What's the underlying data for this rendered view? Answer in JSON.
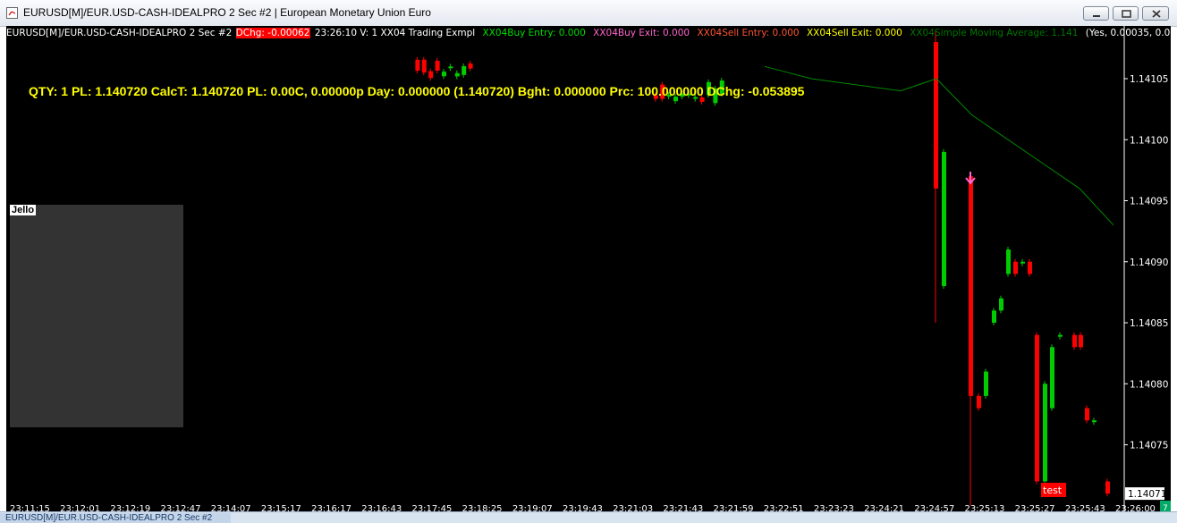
{
  "window": {
    "title": "EURUSD[M]/EUR.USD-CASH-IDEALPRO  2 Sec   #2 | European Monetary Union Euro",
    "controls": [
      "minimize",
      "maximize",
      "close"
    ]
  },
  "chart_header": {
    "symbol": "EURUSD[M]/EUR.USD-CASH-IDEALPRO  2 Sec   #2",
    "dchg": "DChg: -0.00062",
    "time_volume": "23:26:10 V: 1 XX04 Trading Exmpl",
    "buy_entry": "XX04Buy Entry: 0.000",
    "buy_exit": "XX04Buy Exit: 0.000",
    "sell_entry": "XX04Sell Entry: 0.000",
    "sell_exit": "XX04Sell Exit: 0.000",
    "sma": "XX04Simple Moving Average: 1.141",
    "extra": "(Yes, 0.00035, 0.0"
  },
  "position_info": "QTY: 1  PL: 1.140720 CalcT: 1.140720 PL: 0.00C, 0.00000p Day: 0.000000 (1.140720) Bght: 0.000000 Prc: 100.000000 DChg: -0.053895",
  "jello_panel": {
    "label": "Jello"
  },
  "chart_data": {
    "type": "candlestick",
    "y_ticks": [
      "1.14105",
      "1.14100",
      "1.14095",
      "1.14090",
      "1.14085",
      "1.14080",
      "1.14075"
    ],
    "current_price": "1.14071",
    "x_ticks": [
      "23:11:15",
      "23:12:01",
      "23:12:19",
      "23:12:47",
      "23:14:07",
      "23:15:17",
      "23:16:17",
      "23:16:43",
      "23:17:45",
      "23:18:25",
      "23:19:07",
      "23:19:43",
      "23:21:03",
      "23:21:43",
      "23:21:59",
      "23:22:51",
      "23:23:23",
      "23:24:21",
      "23:24:57",
      "23:25:13",
      "23:25:27",
      "23:25:43",
      "23:26:00"
    ],
    "annotations": [
      "test"
    ],
    "scale_corner": "7",
    "colors": {
      "up": "#00cc00",
      "down": "#ff0000",
      "sma": "#008800",
      "signal": "#ff66cc",
      "background": "#000000",
      "dchg_bg": "#ff0000"
    }
  },
  "taskbar": {
    "tab_label": "EURUSD[M]/EUR.USD-CASH-IDEALPRO  2 Sec   #2"
  }
}
